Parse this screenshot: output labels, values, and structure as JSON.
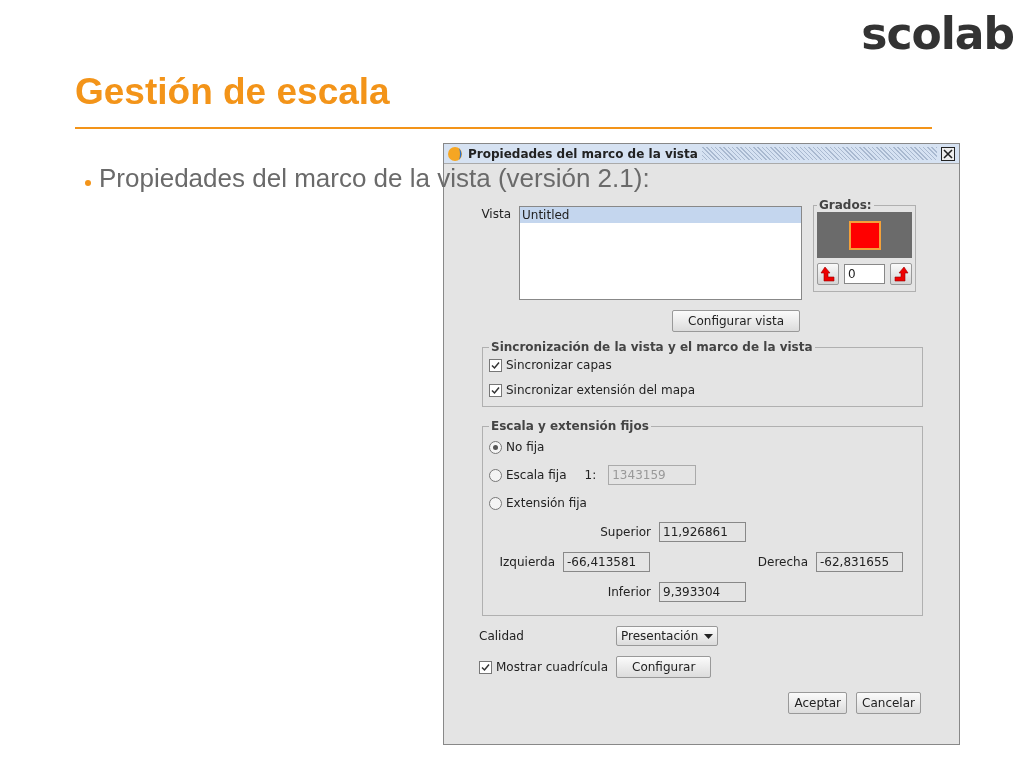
{
  "logo": "scolab",
  "title": "Gestión de escala",
  "bullets": [
    "Propiedades del marco de la vista (versión 2.1):"
  ],
  "dialog": {
    "title": "Propiedades del marco de la vista",
    "vista": {
      "label": "Vista",
      "items": [
        {
          "label": "Untitled",
          "selected": true
        }
      ],
      "button": "Configurar vista"
    },
    "grados": {
      "label": "Grados:",
      "value": "0"
    },
    "sync": {
      "title": "Sincronización de la vista y el marco de la vista",
      "options": [
        {
          "label": "Sincronizar capas",
          "checked": true
        },
        {
          "label": "Sincronizar extensión del mapa",
          "checked": true
        }
      ]
    },
    "escala": {
      "title": "Escala y extensión fijos",
      "options": [
        {
          "label": "No fija",
          "selected": true
        },
        {
          "label": "Escala fija",
          "selected": false
        },
        {
          "label": "Extensión fija",
          "selected": false
        }
      ],
      "scale_prefix": "1:",
      "scale_field": {
        "value": "1343159",
        "disabled": true
      },
      "superior": {
        "label": "Superior",
        "value": "11,926861"
      },
      "izquierda": {
        "label": "Izquierda",
        "value": "-66,413581"
      },
      "derecha": {
        "label": "Derecha",
        "value": "-62,831655"
      },
      "inferior": {
        "label": "Inferior",
        "value": "9,393304"
      }
    },
    "calidad": {
      "label": "Calidad",
      "value": "Presentación"
    },
    "grid": {
      "label": "Mostrar cuadrícula",
      "checked": true,
      "button": "Configurar"
    },
    "buttons": [
      "Aceptar",
      "Cancelar"
    ]
  }
}
